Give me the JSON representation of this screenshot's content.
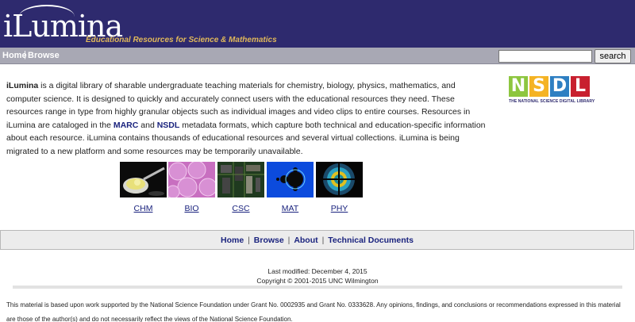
{
  "header": {
    "logo_text": "iLumina",
    "tagline": "Educational Resources for Science & Mathematics"
  },
  "nav": {
    "home": "Home",
    "separator": "|",
    "browse": "Browse"
  },
  "search": {
    "value": "",
    "button_label": "search"
  },
  "intro": {
    "brand": "iLumina",
    "text_1": " is a digital library of sharable undergraduate teaching materials for chemistry, biology, physics, mathematics, and computer science. It is designed to quickly and accurately connect users with the educational resources they need. These resources range in type from highly granular objects such as individual images and video clips to entire courses. Resources in iLumina are cataloged in the ",
    "marc": "MARC",
    "and": " and ",
    "nsdl": "NSDL",
    "text_2": " metadata formats, which capture both technical and education-specific information about each resource. iLumina contains thousands of educational resources and several virtual collections. iLumina is being migrated to a new platform and some resources may be temporarily unavailable."
  },
  "nsdl_logo": {
    "letters": [
      "N",
      "S",
      "D",
      "L"
    ],
    "letter_colors": [
      "#8dc63f",
      "#f5b324",
      "#2e7fc2",
      "#c8202f"
    ],
    "caption": "THE NATIONAL SCIENCE DIGITAL LIBRARY"
  },
  "subjects": [
    {
      "label": "CHM",
      "icon": "chemistry-beaker-image"
    },
    {
      "label": "BIO",
      "icon": "biology-cells-image"
    },
    {
      "label": "CSC",
      "icon": "circuit-board-image"
    },
    {
      "label": "MAT",
      "icon": "mandelbrot-fractal-image"
    },
    {
      "label": "PHY",
      "icon": "diffraction-pattern-image"
    }
  ],
  "footer_nav": {
    "home": "Home",
    "browse": "Browse",
    "about": "About",
    "technical_documents": "Technical Documents",
    "separator": "|"
  },
  "footer": {
    "last_modified": "Last modified: December 4, 2015",
    "copyright": "Copyright © 2001-2015 UNC Wilmington",
    "grant_notice": "This material is based upon work supported by the National Science Foundation under Grant No. 0002935 and Grant No. 0333628. Any opinions, findings, and conclusions or recommendations expressed in this material are those of the author(s) and do not necessarily reflect the views of the National Science Foundation."
  },
  "colors": {
    "header_bg": "#2e2a6e",
    "navbar_bg": "#a8a8b4",
    "tagline": "#e0b85a",
    "link": "#1a237e"
  }
}
